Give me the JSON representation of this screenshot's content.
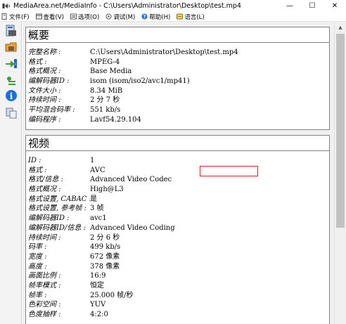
{
  "window": {
    "title": "MediaArea.net/MediaInfo - C:\\Users\\Administrator\\Desktop\\test.mp4",
    "minimize": "—",
    "maximize": "☐",
    "close": "✕"
  },
  "menu": {
    "items": [
      {
        "label": "文件(F)",
        "icon": "file-icon"
      },
      {
        "label": "查看(V)",
        "icon": "view-icon"
      },
      {
        "label": "选项(O)",
        "icon": "options-icon"
      },
      {
        "label": "调试(M)",
        "icon": "debug-icon"
      },
      {
        "label": "帮助(H)",
        "icon": "help-icon"
      },
      {
        "label": "语言(L)",
        "icon": "language-icon"
      }
    ]
  },
  "toolbar": {
    "tools": [
      "open-file-icon",
      "open-folder-icon",
      "export-icon",
      "options-icon",
      "about-icon",
      "knowledge-icon"
    ]
  },
  "general": {
    "title": "概要",
    "rows": [
      {
        "key": "完整名称",
        "value": "C:\\Users\\Administrator\\Desktop\\test.mp4"
      },
      {
        "key": "格式",
        "value": "MPEG-4"
      },
      {
        "key": "格式概况",
        "value": "Base Media"
      },
      {
        "key": "编解码器ID",
        "value": "isom (isom/iso2/avc1/mp41)"
      },
      {
        "key": "文件大小",
        "value": "8.34 MiB"
      },
      {
        "key": "持续时间",
        "value": "2 分 7 秒"
      },
      {
        "key": "平均混合码率",
        "value": "551 kb/s"
      },
      {
        "key": "编码程序",
        "value": "Lavf54.29.104"
      }
    ]
  },
  "video": {
    "title": "视频",
    "rows": [
      {
        "key": "ID",
        "value": "1"
      },
      {
        "key": "格式",
        "value": "AVC"
      },
      {
        "key": "格式/信息",
        "value": "Advanced Video Codec"
      },
      {
        "key": "格式概况",
        "value": "High@L3"
      },
      {
        "key": "格式设置, CABAC",
        "value": "是"
      },
      {
        "key": "格式设置, 参考帧",
        "value": "3 帧"
      },
      {
        "key": "编解码器ID",
        "value": "avc1"
      },
      {
        "key": "编解码器ID/信息",
        "value": "Advanced Video Coding"
      },
      {
        "key": "持续时间",
        "value": "2 分 6 秒"
      },
      {
        "key": "码率",
        "value": "499 kb/s"
      },
      {
        "key": "宽度",
        "value": "672 像素"
      },
      {
        "key": "高度",
        "value": "378 像素"
      },
      {
        "key": "画面比例",
        "value": "16:9"
      },
      {
        "key": "帧率模式",
        "value": "恒定"
      },
      {
        "key": "帧率",
        "value": "25.000 帧/秒"
      },
      {
        "key": "色彩空间",
        "value": "YUV"
      },
      {
        "key": "色度抽样",
        "value": "4:2:0"
      }
    ]
  },
  "colors": {
    "highlight": "#e02020",
    "border": "#828282"
  }
}
